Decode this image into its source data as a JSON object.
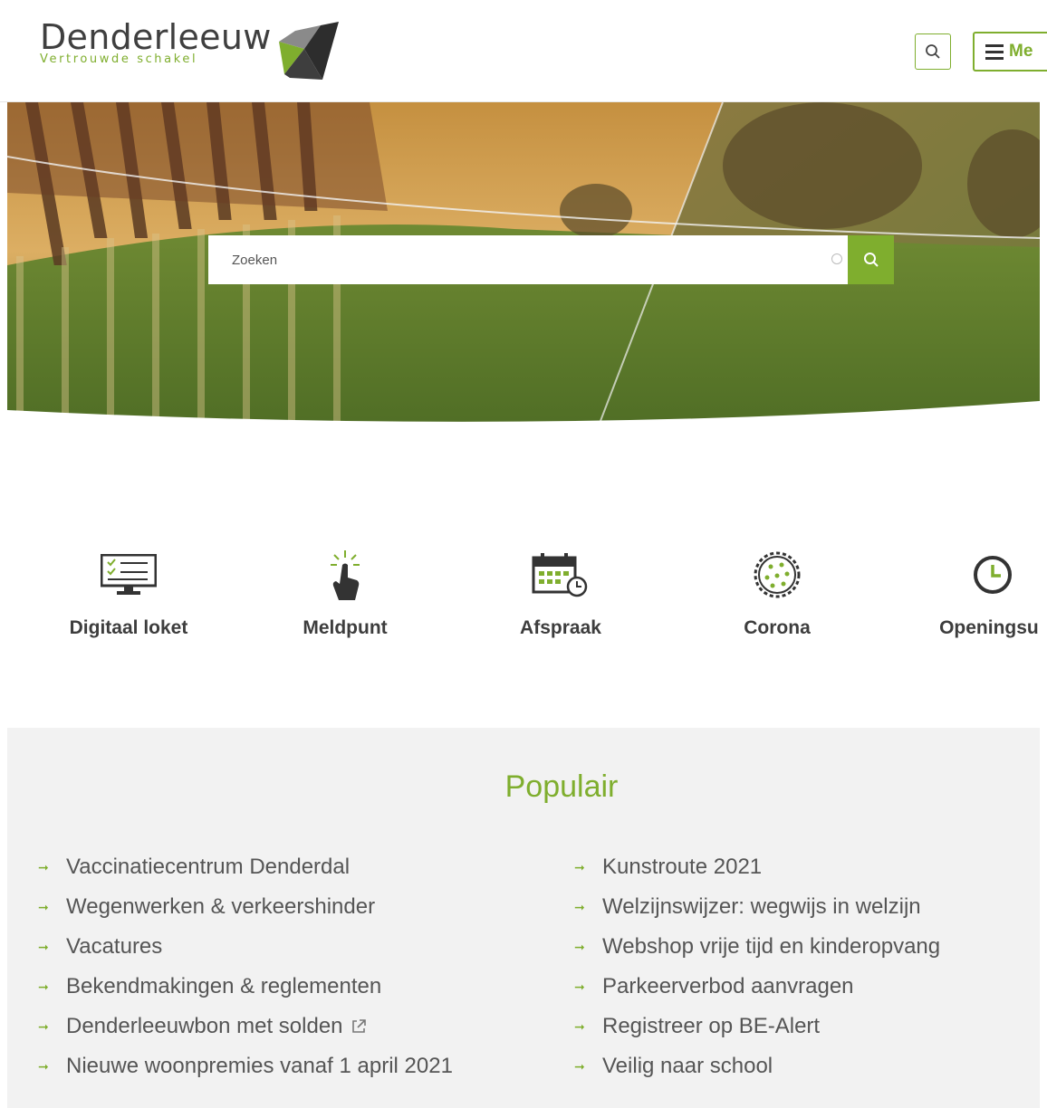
{
  "header": {
    "logo_name": "Denderleeuw",
    "logo_tagline": "Vertrouwde schakel",
    "menu_label": "Me"
  },
  "search": {
    "placeholder": "Zoeken"
  },
  "quick_links": [
    {
      "label": "Digitaal loket",
      "icon": "computer-checklist-icon"
    },
    {
      "label": "Meldpunt",
      "icon": "pointing-hand-icon"
    },
    {
      "label": "Afspraak",
      "icon": "calendar-clock-icon"
    },
    {
      "label": "Corona",
      "icon": "virus-icon"
    },
    {
      "label": "Openingsur",
      "icon": "clock-icon"
    }
  ],
  "populair": {
    "title": "Populair",
    "left": [
      "Vaccinatiecentrum Denderdal",
      "Wegenwerken & verkeershinder",
      "Vacatures",
      "Bekendmakingen & reglementen",
      "Denderleeuwbon met solden",
      "Nieuwe woonpremies vanaf 1 april 2021"
    ],
    "right": [
      "Kunstroute 2021",
      "Welzijnswijzer: wegwijs in welzijn",
      "Webshop vrije tijd en kinderopvang",
      "Parkeerverbod aanvragen",
      "Registreer op BE-Alert",
      "Veilig naar school"
    ]
  },
  "colors": {
    "accent": "#7fae2e",
    "text": "#444444",
    "panel": "#f2f2f2"
  }
}
